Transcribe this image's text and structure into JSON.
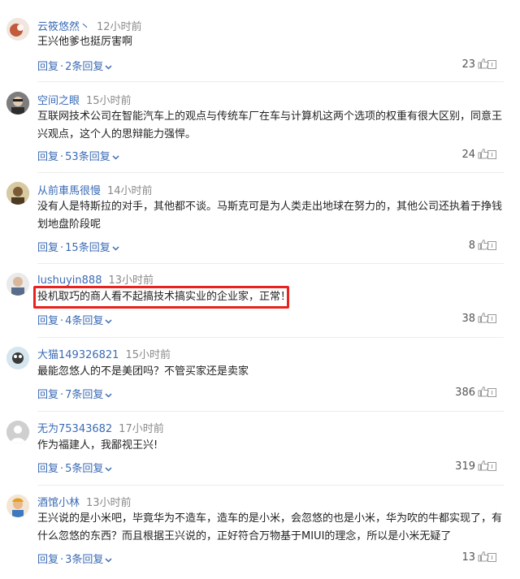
{
  "comments": [
    {
      "username": "云筱悠然丶",
      "time": "12小时前",
      "text": "王兴他爹也挺厉害啊",
      "reply_label": "回复",
      "replies_label": "2条回复",
      "likes": "23"
    },
    {
      "username": "空间之眼",
      "time": "15小时前",
      "text": "互联网技术公司在智能汽车上的观点与传统车厂在车与计算机这两个选项的权重有很大区别，同意王兴观点，这个人的思辩能力强悍。",
      "reply_label": "回复",
      "replies_label": "53条回复",
      "likes": "24"
    },
    {
      "username": "从前車馬很慢",
      "time": "14小时前",
      "text": "没有人是特斯拉的对手，其他都不谈。马斯克可是为人类走出地球在努力的，其他公司还执着于挣钱划地盘阶段呢",
      "reply_label": "回复",
      "replies_label": "15条回复",
      "likes": "8"
    },
    {
      "username": "lushuyin888",
      "time": "13小时前",
      "text": "投机取巧的商人看不起搞技术搞实业的企业家，正常！",
      "reply_label": "回复",
      "replies_label": "4条回复",
      "likes": "38"
    },
    {
      "username": "大猫149326821",
      "time": "15小时前",
      "text": "最能忽悠人的不是美团吗？不管买家还是卖家",
      "reply_label": "回复",
      "replies_label": "7条回复",
      "likes": "386"
    },
    {
      "username": "无为75343682",
      "time": "17小时前",
      "text": "作为福建人，我鄙视王兴!",
      "reply_label": "回复",
      "replies_label": "5条回复",
      "likes": "319"
    },
    {
      "username": "酒馆小林",
      "time": "13小时前",
      "text": "王兴说的是小米吧，毕竟华为不造车，造车的是小米，会忽悠的也是小米，华为吹的牛都实现了，有什么忽悠的东西？而且根据王兴说的，正好符合万物基于MIUI的理念，所以是小米无疑了",
      "reply_label": "回复",
      "replies_label": "3条回复",
      "likes": "13"
    }
  ],
  "colors": {
    "link": "#3b6bb5",
    "highlight": "#e8221c",
    "meta": "#8a8a8a"
  }
}
